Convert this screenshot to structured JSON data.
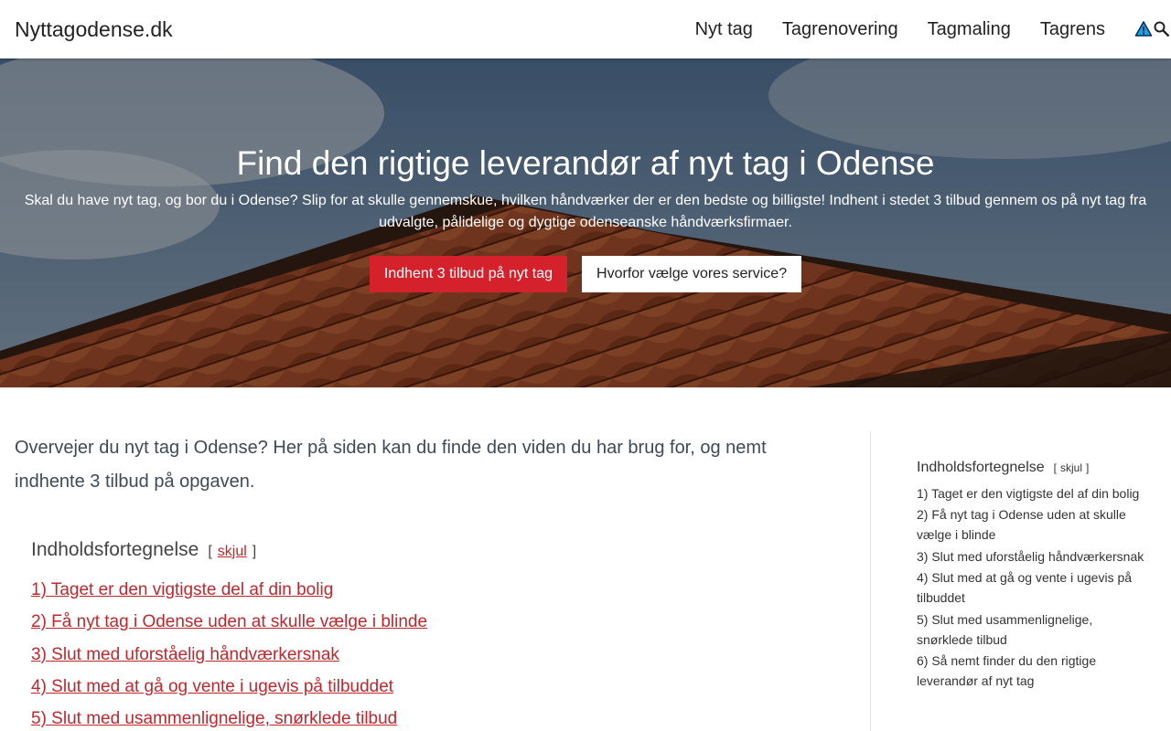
{
  "header": {
    "brand": "Nyttagodense.dk",
    "nav": [
      "Nyt tag",
      "Tagrenovering",
      "Tagmaling",
      "Tagrens"
    ],
    "icons": [
      "warning-icon",
      "search-icon"
    ]
  },
  "hero": {
    "title": "Find den rigtige leverandør af nyt tag i Odense",
    "text": "Skal du have nyt tag, og bor du i Odense? Slip for at skulle gennemskue, hvilken håndværker der er den bedste og billigste! Indhent i stedet 3 tilbud gennem os på nyt tag fra udvalgte, pålidelige og dygtige odenseanske håndværksfirmaer.",
    "cta_primary": "Indhent 3 tilbud på nyt tag",
    "cta_secondary": "Hvorfor vælge vores service?"
  },
  "main": {
    "intro": "Overvejer du nyt tag i Odense? Her på siden kan du finde den viden du har brug for, og nemt indhente 3 tilbud på opgaven.",
    "toc_title": "Indholdsfortegnelse",
    "toc_bracket_open": "[",
    "toc_toggle": "skjul",
    "toc_bracket_close": "]",
    "toc_items": [
      "1) Taget er den vigtigste del af din bolig",
      "2) Få nyt tag i Odense uden at skulle vælge i blinde",
      "3) Slut med uforståelig håndværkersnak",
      "4) Slut med at gå og vente i ugevis på tilbuddet",
      "5) Slut med usammenlignelige, snørklede tilbud"
    ]
  },
  "sidebar": {
    "toc_title": "Indholdsfortegnelse",
    "toc_bracket_open": "[",
    "toc_toggle": "skjul",
    "toc_bracket_close": "]",
    "toc_items": [
      "1) Taget er den vigtigste del af din bolig",
      "2) Få nyt tag i Odense uden at skulle vælge i blinde",
      "3) Slut med uforståelig håndværkersnak",
      "4) Slut med at gå og vente i ugevis på tilbuddet",
      "5) Slut med usammenlignelige, snørklede tilbud",
      "6) Så nemt finder du den rigtige leverandør af nyt tag"
    ]
  },
  "colors": {
    "accent_red": "#d4212b",
    "link_red": "#c0272d"
  }
}
